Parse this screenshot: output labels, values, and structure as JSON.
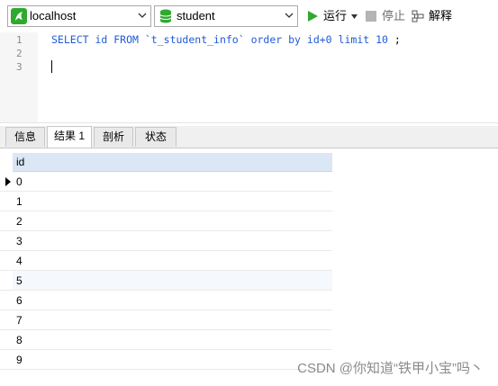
{
  "toolbar": {
    "connection": "localhost",
    "database": "student",
    "run_label": "运行",
    "stop_label": "停止",
    "explain_label": "解释"
  },
  "editor": {
    "line_numbers": [
      "1",
      "2",
      "3"
    ],
    "sql": {
      "t1": "SELECT",
      "t2": " id ",
      "t3": "FROM",
      "t4": " `t_student_info` ",
      "t5": "order by",
      "t6": " id+",
      "t7": "0",
      "t8": " ",
      "t9": "limit",
      "t10": " ",
      "t11": "10",
      "t12": " ;"
    }
  },
  "tabs": [
    "信息",
    "结果 1",
    "剖析",
    "状态"
  ],
  "grid": {
    "column": "id",
    "rows": [
      "0",
      "1",
      "2",
      "3",
      "4",
      "5",
      "6",
      "7",
      "8",
      "9"
    ]
  },
  "watermark": "CSDN @你知道“铁甲小宝”吗丶",
  "colors": {
    "keyword": "#1f5ad9",
    "run_green": "#2eaa2e",
    "header_bg": "#dbe7f5"
  }
}
